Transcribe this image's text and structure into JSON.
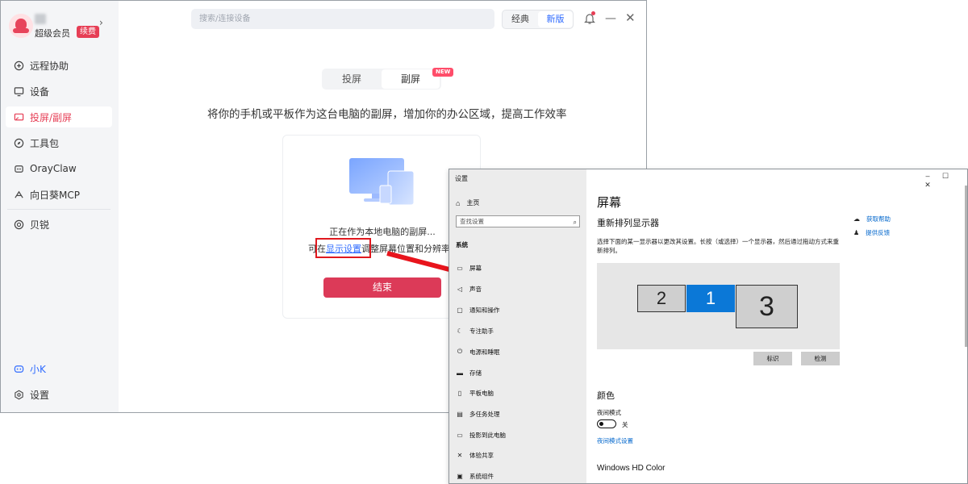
{
  "app": {
    "profile": {
      "vip_label": "超级会员",
      "renew_badge": "续费",
      "chevron": "›"
    },
    "nav": [
      {
        "label": "远程协助",
        "icon": "remote-assist-icon"
      },
      {
        "label": "设备",
        "icon": "monitor-icon"
      },
      {
        "label": "投屏/副屏",
        "icon": "cast-screen-icon",
        "active": true
      },
      {
        "label": "工具包",
        "icon": "compass-icon"
      },
      {
        "label": "OrayClaw",
        "icon": "claw-icon"
      },
      {
        "label": "向日葵MCP",
        "icon": "mcp-icon"
      },
      {
        "label": "贝锐",
        "icon": "oray-logo-icon"
      }
    ],
    "bottom_nav": [
      {
        "label": "小K",
        "icon": "assistant-bot-icon"
      },
      {
        "label": "设置",
        "icon": "gear-icon"
      }
    ],
    "search_placeholder": "搜索/连接设备",
    "mode": {
      "classic": "经典",
      "new": "新版",
      "selected": "新版"
    },
    "tabs": {
      "cast": "投屏",
      "second_screen": "副屏",
      "new_badge": "NEW",
      "selected": "副屏"
    },
    "headline": "将你的手机或平板作为这台电脑的副屏，增加你的办公区域，提高工作效率",
    "card": {
      "status": "正在作为本地电脑的副屏...",
      "hint_prefix": "可在",
      "hint_link": "显示设置",
      "hint_suffix": "调整屏幕位置和分辨率",
      "end_button": "结束"
    },
    "accent_color": "#e63e55",
    "link_color": "#2f6bff"
  },
  "settings": {
    "title": "设置",
    "home": "主页",
    "search_placeholder": "查找设置",
    "section": "系统",
    "items": [
      {
        "label": "屏幕",
        "icon": "display-icon"
      },
      {
        "label": "声音",
        "icon": "speaker-icon"
      },
      {
        "label": "通知和操作",
        "icon": "notification-icon"
      },
      {
        "label": "专注助手",
        "icon": "moon-icon"
      },
      {
        "label": "电源和睡眠",
        "icon": "power-icon"
      },
      {
        "label": "存储",
        "icon": "storage-icon"
      },
      {
        "label": "平板电脑",
        "icon": "tablet-icon"
      },
      {
        "label": "多任务处理",
        "icon": "multitask-icon"
      },
      {
        "label": "投影到此电脑",
        "icon": "project-icon"
      },
      {
        "label": "体验共享",
        "icon": "share-icon"
      },
      {
        "label": "系统组件",
        "icon": "components-icon"
      }
    ],
    "page_title": "屏幕",
    "rearrange_title": "重新排列显示器",
    "rearrange_desc": "选择下面的某一显示器以更改其设置。长按（或选择）一个显示器，然后通过拖动方式来重新排列。",
    "monitors": [
      {
        "number": "2",
        "selected": false
      },
      {
        "number": "1",
        "selected": true
      },
      {
        "number": "3",
        "selected": false
      }
    ],
    "identify_button": "标识",
    "detect_button": "检测",
    "help_link": "获取帮助",
    "feedback_link": "提供反馈",
    "color_title": "颜色",
    "night_mode_label": "夜间模式",
    "night_mode_state": "关",
    "night_mode_link": "夜间模式设置",
    "hdr_title": "Windows HD Color",
    "window_controls": [
      "–",
      "☐",
      "✕"
    ],
    "selected_color": "#0b78d7"
  }
}
